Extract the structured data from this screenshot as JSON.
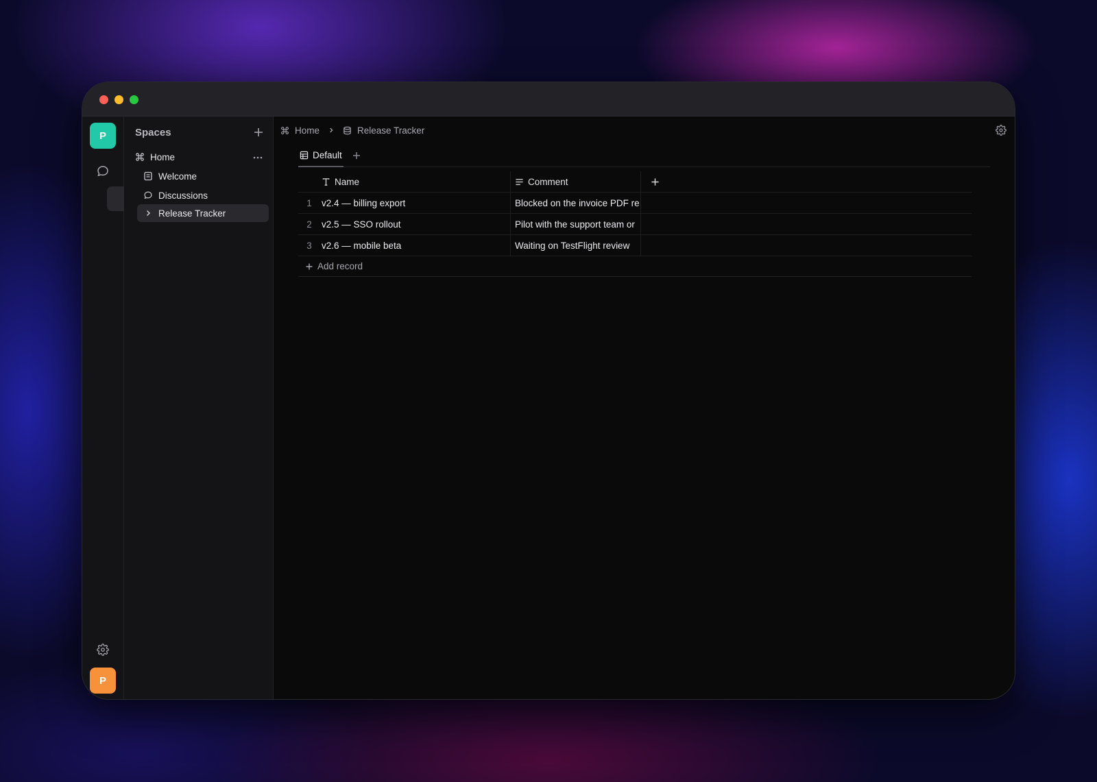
{
  "sidebar": {
    "rail": {
      "top_avatar": "P",
      "bottom_avatar": "P"
    },
    "spaces_title": "Spaces",
    "home": "Home",
    "items": [
      {
        "label": "Welcome",
        "icon": "page-icon"
      },
      {
        "label": "Discussions",
        "icon": "chat-bubble-icon"
      },
      {
        "label": "Release Tracker",
        "icon": "chevron-right-icon"
      }
    ]
  },
  "breadcrumb": {
    "home": "Home",
    "current": "Release Tracker"
  },
  "tabs": {
    "default": "Default"
  },
  "table": {
    "columns": [
      {
        "label": "Name",
        "icon": "text-type-icon"
      },
      {
        "label": "Comment",
        "icon": "lines-icon"
      }
    ],
    "rows": [
      {
        "index": "1",
        "name": "v2.4 — billing export",
        "comment": "Blocked on the invoice PDF re"
      },
      {
        "index": "2",
        "name": "v2.5 — SSO rollout",
        "comment": "Pilot with the support team or"
      },
      {
        "index": "3",
        "name": "v2.6 — mobile beta",
        "comment": "Waiting on TestFlight review"
      }
    ],
    "add_record": "Add record"
  },
  "colors": {
    "accent_teal": "#22c9a8",
    "accent_orange": "#f7923a",
    "background": "#0a0a0a"
  }
}
